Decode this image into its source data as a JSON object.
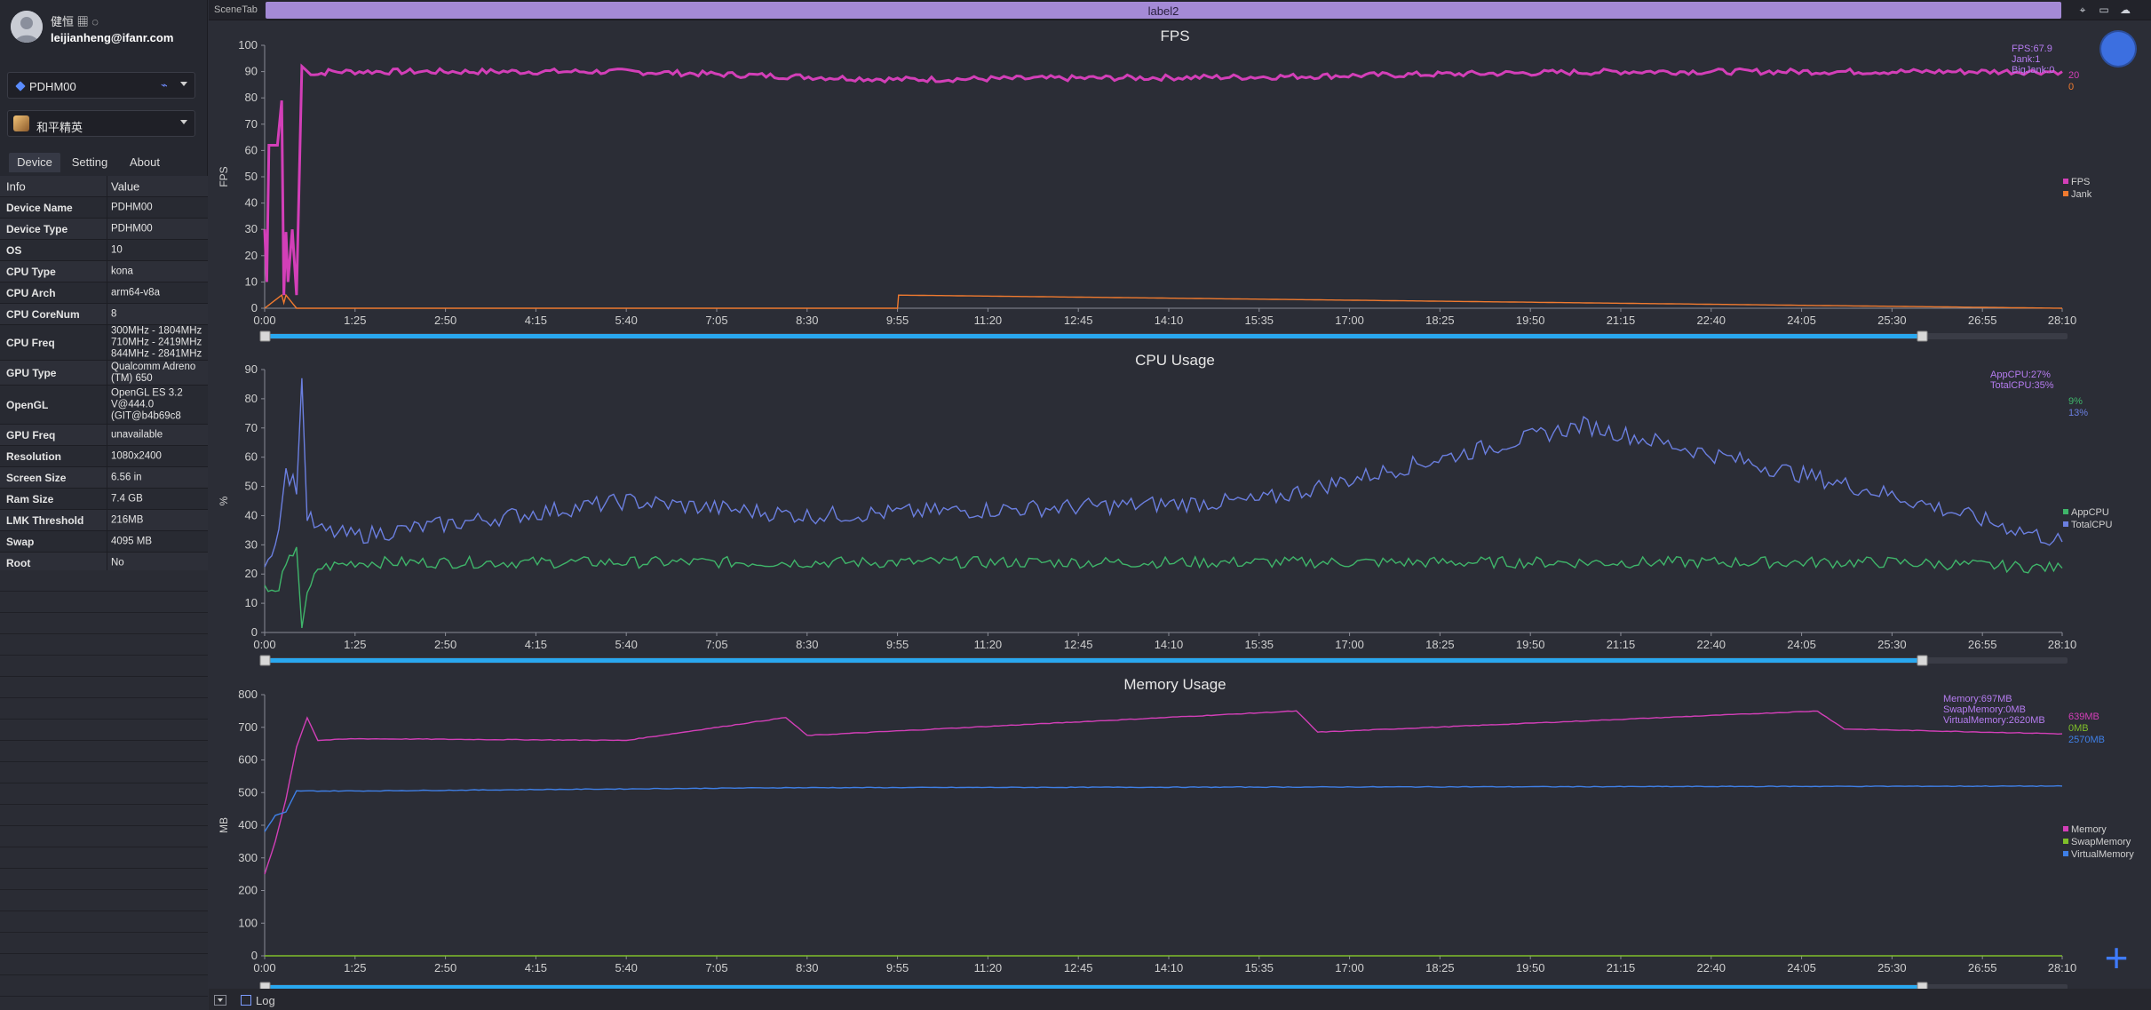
{
  "profile": {
    "username": "健恒 ▦ ◌",
    "email": "leijianheng@ifanr.com"
  },
  "device_select": {
    "value": "PDHM00"
  },
  "app_select": {
    "value": "和平精英"
  },
  "tabs": [
    "Device",
    "Setting",
    "About"
  ],
  "info_table": {
    "header": {
      "key": "Info",
      "value": "Value"
    },
    "rows": [
      {
        "key": "Device Name",
        "value": "PDHM00"
      },
      {
        "key": "Device Type",
        "value": "PDHM00"
      },
      {
        "key": "OS",
        "value": "10"
      },
      {
        "key": "CPU Type",
        "value": "kona"
      },
      {
        "key": "CPU Arch",
        "value": "arm64-v8a"
      },
      {
        "key": "CPU CoreNum",
        "value": "8"
      },
      {
        "key": "CPU Freq",
        "value": "300MHz - 1804MHz\n710MHz - 2419MHz\n844MHz - 2841MHz"
      },
      {
        "key": "GPU Type",
        "value": "Qualcomm Adreno (TM) 650"
      },
      {
        "key": "OpenGL",
        "value": "OpenGL ES 3.2 V@444.0 (GIT@b4b69c8"
      },
      {
        "key": "GPU Freq",
        "value": "unavailable"
      },
      {
        "key": "Resolution",
        "value": "1080x2400"
      },
      {
        "key": "Screen Size",
        "value": "6.56 in"
      },
      {
        "key": "Ram Size",
        "value": "7.4 GB"
      },
      {
        "key": "LMK Threshold",
        "value": "216MB"
      },
      {
        "key": "Swap",
        "value": "4095 MB"
      },
      {
        "key": "Root",
        "value": "No"
      }
    ]
  },
  "topbar": {
    "scene_tab": "SceneTab",
    "label": "label2"
  },
  "bottombar": {
    "log_label": "Log"
  },
  "colors": {
    "fps": "#d33fb8",
    "jank": "#f07a2f",
    "app_cpu": "#3fb56a",
    "total_cpu": "#6b7fe0",
    "memory": "#d33fb8",
    "swap_memory": "#7fbf2a",
    "virtual_memory": "#3f7fe6",
    "accent": "#29a8f0"
  },
  "icons": [
    "pin-icon",
    "folder-icon",
    "cloud-icon",
    "usb-icon",
    "add-icon"
  ],
  "x_ticks": [
    "0:00",
    "1:25",
    "2:50",
    "4:15",
    "5:40",
    "7:05",
    "8:30",
    "9:55",
    "11:20",
    "12:45",
    "14:10",
    "15:35",
    "17:00",
    "18:25",
    "19:50",
    "21:15",
    "22:40",
    "24:05",
    "25:30",
    "26:55",
    "28:10"
  ],
  "chart_data": [
    {
      "type": "line",
      "title": "FPS",
      "ylabel": "FPS",
      "ylim": [
        0,
        100
      ],
      "yticks": [
        "0",
        "10",
        "20",
        "30",
        "40",
        "50",
        "60",
        "70",
        "80",
        "90",
        "100"
      ],
      "legend": [
        "FPS",
        "Jank"
      ],
      "legend_position": "right",
      "stats": [
        "FPS:67.9",
        "Jank:1",
        "BigJank:0"
      ],
      "right_values": [
        "20",
        "0"
      ],
      "series": [
        {
          "name": "FPS",
          "x": [
            "0:00",
            "0:02",
            "0:04",
            "0:07",
            "0:12",
            "0:16",
            "0:18",
            "0:20",
            "0:22",
            "0:26",
            "0:30",
            "0:35",
            "0:40",
            "0:50",
            "1:00",
            "1:25",
            "5:40",
            "9:55",
            "15:35",
            "21:15",
            "28:10"
          ],
          "values": [
            30,
            10,
            62,
            62,
            62,
            79,
            5,
            29,
            10,
            30,
            5,
            92,
            90,
            89,
            90,
            90,
            90,
            87,
            88,
            90,
            90
          ]
        },
        {
          "name": "Jank",
          "x": [
            "0:00",
            "0:16",
            "0:18",
            "0:20",
            "0:24",
            "0:30",
            "9:55",
            "9:56",
            "28:10"
          ],
          "values": [
            0,
            5,
            2,
            5,
            3,
            0,
            0,
            5,
            0
          ]
        }
      ]
    },
    {
      "type": "line",
      "title": "CPU Usage",
      "ylabel": "%",
      "ylim": [
        0,
        90
      ],
      "yticks": [
        "0",
        "10",
        "20",
        "30",
        "40",
        "50",
        "60",
        "70",
        "80",
        "90"
      ],
      "legend": [
        "AppCPU",
        "TotalCPU"
      ],
      "legend_position": "right",
      "stats": [
        "AppCPU:27%",
        "TotalCPU:35%"
      ],
      "right_values": [
        "9%",
        "13%"
      ],
      "series": [
        {
          "name": "AppCPU",
          "x": [
            "0:00",
            "0:10",
            "0:20",
            "0:30",
            "0:35",
            "0:40",
            "0:50",
            "1:25",
            "5:40",
            "8:30",
            "15:35",
            "20:40",
            "25:30",
            "28:10"
          ],
          "values": [
            15,
            13,
            22,
            30,
            2,
            12,
            22,
            24,
            24,
            24,
            24,
            24,
            24,
            22
          ]
        },
        {
          "name": "TotalCPU",
          "x": [
            "0:00",
            "0:10",
            "0:20",
            "0:30",
            "0:35",
            "0:40",
            "0:50",
            "1:25",
            "5:40",
            "8:30",
            "15:35",
            "20:40",
            "25:30",
            "28:10"
          ],
          "values": [
            25,
            30,
            55,
            50,
            86,
            40,
            35,
            33,
            45,
            40,
            45,
            71,
            47,
            31
          ]
        }
      ]
    },
    {
      "type": "line",
      "title": "Memory Usage",
      "ylabel": "MB",
      "ylim": [
        0,
        800
      ],
      "yticks": [
        "0",
        "100",
        "200",
        "300",
        "400",
        "500",
        "600",
        "700",
        "800"
      ],
      "legend": [
        "Memory",
        "SwapMemory",
        "VirtualMemory"
      ],
      "legend_position": "right",
      "stats": [
        "Memory:697MB",
        "SwapMemory:0MB",
        "VirtualMemory:2620MB"
      ],
      "right_values": [
        "639MB",
        "0MB",
        "2570MB"
      ],
      "series": [
        {
          "name": "Memory",
          "x": [
            "0:00",
            "0:10",
            "0:20",
            "0:30",
            "0:40",
            "0:50",
            "1:25",
            "5:40",
            "8:10",
            "8:30",
            "16:10",
            "16:30",
            "24:20",
            "24:45",
            "28:10"
          ],
          "values": [
            250,
            350,
            480,
            640,
            730,
            660,
            665,
            660,
            730,
            675,
            750,
            685,
            750,
            695,
            680
          ]
        },
        {
          "name": "SwapMemory",
          "x": [
            "0:00",
            "28:10"
          ],
          "values": [
            0,
            0
          ]
        },
        {
          "name": "VirtualMemory",
          "x": [
            "0:00",
            "0:10",
            "0:20",
            "0:30",
            "1:25",
            "8:10",
            "28:10"
          ],
          "values": [
            380,
            430,
            440,
            505,
            505,
            515,
            520
          ]
        }
      ]
    }
  ]
}
